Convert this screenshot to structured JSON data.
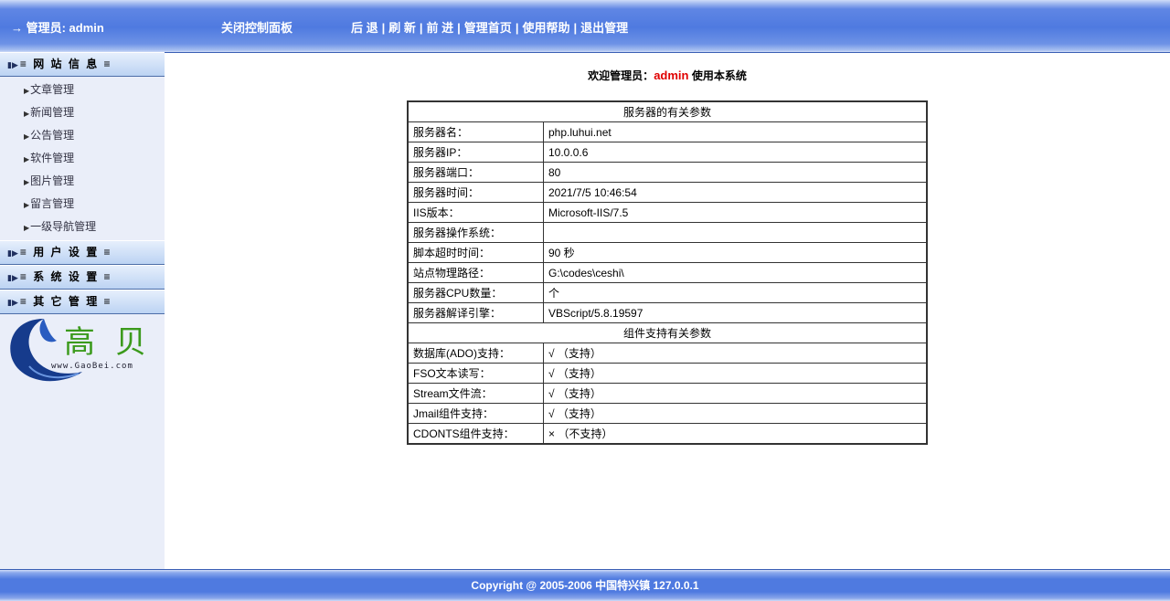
{
  "header": {
    "admin_label": "→ 管理员: admin",
    "close_panel": "关闭控制面板",
    "nav": [
      "后 退",
      "刷 新",
      "前 进",
      "管理首页",
      "使用帮助",
      "退出管理"
    ],
    "nav_separator": "|"
  },
  "sidebar": {
    "sections": [
      {
        "label": "≡ 网 站 信 息 ≡",
        "items": [
          "文章管理",
          "新闻管理",
          "公告管理",
          "软件管理",
          "图片管理",
          "留言管理",
          "一级导航管理"
        ]
      },
      {
        "label": "≡ 用 户 设 置 ≡"
      },
      {
        "label": "≡ 系 统 设 置 ≡"
      },
      {
        "label": "≡ 其 它 管 理 ≡"
      }
    ],
    "logo": {
      "site": "www.GaoBei.com",
      "chars": "高贝"
    }
  },
  "welcome": {
    "prefix": "欢迎管理员：",
    "name": "admin",
    "suffix": " 使用本系统"
  },
  "server_info": {
    "title": "服务器的有关参数",
    "rows": [
      {
        "key": "服务器名：",
        "value": "php.luhui.net"
      },
      {
        "key": "服务器IP：",
        "value": "10.0.0.6"
      },
      {
        "key": "服务器端口：",
        "value": "80"
      },
      {
        "key": "服务器时间：",
        "value": "2021/7/5 10:46:54"
      },
      {
        "key": "IIS版本：",
        "value": "Microsoft-IIS/7.5"
      },
      {
        "key": "服务器操作系统：",
        "value": ""
      },
      {
        "key": "脚本超时时间：",
        "value": "90 秒"
      },
      {
        "key": "站点物理路径：",
        "value": "G:\\codes\\ceshi\\"
      },
      {
        "key": "服务器CPU数量：",
        "value": "个"
      },
      {
        "key": "服务器解译引擎：",
        "value": "VBScript/5.8.19597"
      }
    ]
  },
  "components": {
    "title": "组件支持有关参数",
    "rows": [
      {
        "key": "数据库(ADO)支持：",
        "value": "√ （支持）"
      },
      {
        "key": "FSO文本读写：",
        "value": "√ （支持）"
      },
      {
        "key": "Stream文件流：",
        "value": "√ （支持）"
      },
      {
        "key": "Jmail组件支持：",
        "value": "√ （支持）"
      },
      {
        "key": "CDONTS组件支持：",
        "value": "× （不支持）"
      }
    ]
  },
  "footer": {
    "text": "Copyright @ 2005-2006 中国特兴镇  127.0.0.1"
  }
}
